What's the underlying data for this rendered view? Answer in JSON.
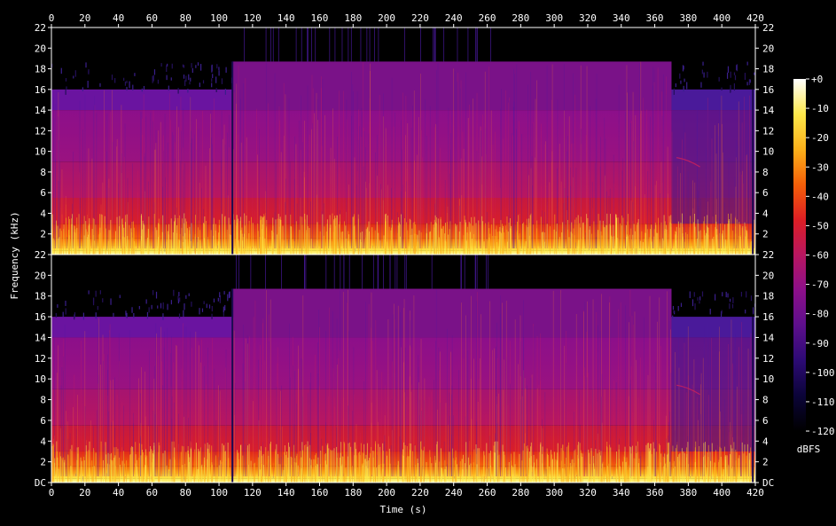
{
  "chart_data": {
    "type": "heatmap",
    "kind": "spectrogram",
    "channels": 2,
    "xlabel": "Time (s)",
    "ylabel": "Frequency (kHz)",
    "colorbar_label": "dBFS",
    "x_ticks": [
      0,
      20,
      40,
      60,
      80,
      100,
      120,
      140,
      160,
      180,
      200,
      220,
      240,
      260,
      280,
      300,
      320,
      340,
      360,
      380,
      400,
      420
    ],
    "xlim": [
      0,
      420
    ],
    "y_ticks": [
      {
        "value": 0,
        "label": "DC"
      },
      {
        "value": 2,
        "label": "2"
      },
      {
        "value": 4,
        "label": "4"
      },
      {
        "value": 6,
        "label": "6"
      },
      {
        "value": 8,
        "label": "8"
      },
      {
        "value": 10,
        "label": "10"
      },
      {
        "value": 12,
        "label": "12"
      },
      {
        "value": 14,
        "label": "14"
      },
      {
        "value": 16,
        "label": "16"
      },
      {
        "value": 18,
        "label": "18"
      },
      {
        "value": 20,
        "label": "20"
      },
      {
        "value": 22,
        "label": "22"
      }
    ],
    "ylim": [
      0,
      22
    ],
    "colorbar_ticks": [
      "+0",
      "-10",
      "-20",
      "-30",
      "-40",
      "-50",
      "-60",
      "-70",
      "-80",
      "-90",
      "-100",
      "-110",
      "-120"
    ],
    "colorbar_range": [
      -120,
      0
    ],
    "colormap": [
      "#000000",
      "#0b0438",
      "#2c0a74",
      "#5d0f8c",
      "#8c0f8a",
      "#b81660",
      "#dd1e24",
      "#f45f08",
      "#fbb01a",
      "#fde84a",
      "#ffffff"
    ],
    "segments": [
      {
        "start": 0,
        "end": 108,
        "cutoff_khz": 16,
        "sparse_to_khz": 18.7,
        "body_level_db": -70
      },
      {
        "start": 108,
        "end": 370,
        "cutoff_khz": 18.7,
        "body_level_db": -76
      },
      {
        "start": 370,
        "end": 420,
        "cutoff_khz": 16,
        "sparse_to_khz": 18.7,
        "body_level_db": -90
      }
    ]
  }
}
